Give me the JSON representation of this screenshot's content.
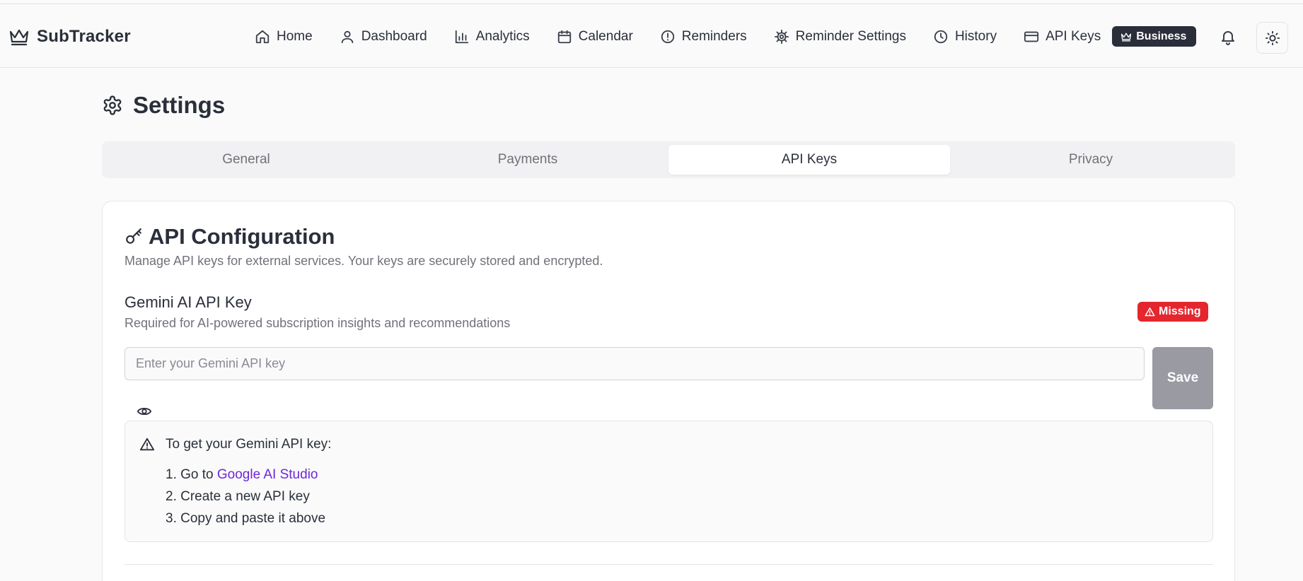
{
  "brand": {
    "name": "SubTracker"
  },
  "nav": {
    "items": [
      {
        "label": "Home",
        "icon": "home-icon"
      },
      {
        "label": "Dashboard",
        "icon": "user-icon"
      },
      {
        "label": "Analytics",
        "icon": "bar-chart-icon"
      },
      {
        "label": "Calendar",
        "icon": "calendar-icon"
      },
      {
        "label": "Reminders",
        "icon": "alert-circle-icon"
      },
      {
        "label": "Reminder Settings",
        "icon": "cog-icon"
      },
      {
        "label": "History",
        "icon": "clock-icon"
      },
      {
        "label": "API Keys",
        "icon": "credit-card-icon"
      }
    ],
    "plan_badge": "Business"
  },
  "page": {
    "title": "Settings"
  },
  "tabs": [
    {
      "label": "General",
      "active": false
    },
    {
      "label": "Payments",
      "active": false
    },
    {
      "label": "API Keys",
      "active": true
    },
    {
      "label": "Privacy",
      "active": false
    }
  ],
  "api_card": {
    "title": "API Configuration",
    "description": "Manage API keys for external services. Your keys are securely stored and encrypted.",
    "gemini": {
      "label": "Gemini AI API Key",
      "description": "Required for AI-powered subscription insights and recommendations",
      "status": "Missing",
      "placeholder": "Enter your Gemini API key",
      "value": "",
      "save_label": "Save"
    },
    "instructions": {
      "title": "To get your Gemini API key:",
      "step1_prefix": "1. Go to ",
      "step1_link": "Google AI Studio",
      "step2": "2. Create a new API key",
      "step3": "3. Copy and paste it above"
    }
  },
  "colors": {
    "accent_dark": "#2a2d3a",
    "danger": "#e5262e",
    "link": "#6d28d9",
    "save_disabled": "#9a9aa3"
  }
}
